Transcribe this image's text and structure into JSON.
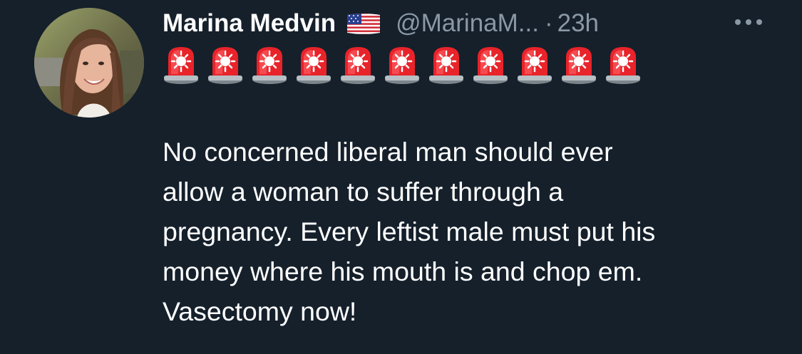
{
  "tweet": {
    "author_name": "Marina Medvin",
    "flag_icon": "us-flag-icon",
    "handle": "@MarinaM...",
    "separator": "·",
    "time": "23h",
    "more_icon": "more-horizontal-icon",
    "siren_icon": "police-car-light-icon",
    "siren_count": 11,
    "text_lines": [
      "No concerned liberal man should ever",
      "allow a woman to suffer through a",
      "pregnancy. Every leftist male must put his",
      "money where his mouth is and chop em.",
      "Vasectomy now!"
    ]
  },
  "colors": {
    "background": "#15202b",
    "primary_text": "#ffffff",
    "secondary_text": "#8b98a5",
    "siren_red": "#e8232a"
  }
}
